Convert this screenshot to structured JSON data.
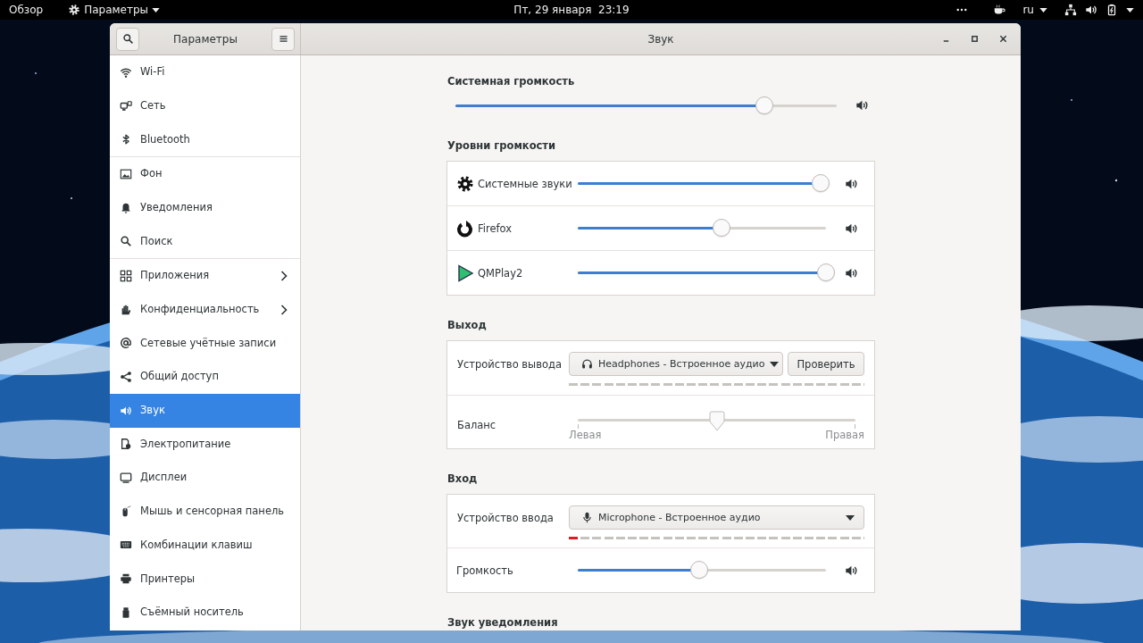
{
  "top_bar": {
    "activities": "Обзор",
    "app_menu": "Параметры",
    "clock": "Пт, 29 января  23:19",
    "language": "ru"
  },
  "window": {
    "sidebar_title": "Параметры",
    "title": "Звук"
  },
  "sidebar": {
    "groups": [
      [
        {
          "label": "Wi-Fi",
          "selected": false,
          "has_submenu": false
        },
        {
          "label": "Сеть",
          "selected": false,
          "has_submenu": false
        },
        {
          "label": "Bluetooth",
          "selected": false,
          "has_submenu": false
        }
      ],
      [
        {
          "label": "Фон",
          "selected": false,
          "has_submenu": false
        },
        {
          "label": "Уведомления",
          "selected": false,
          "has_submenu": false
        },
        {
          "label": "Поиск",
          "selected": false,
          "has_submenu": false
        }
      ],
      [
        {
          "label": "Приложения",
          "selected": false,
          "has_submenu": true
        },
        {
          "label": "Конфиденциальность",
          "selected": false,
          "has_submenu": true
        },
        {
          "label": "Сетевые учётные записи",
          "selected": false,
          "has_submenu": false
        },
        {
          "label": "Общий доступ",
          "selected": false,
          "has_submenu": false
        },
        {
          "label": "Звук",
          "selected": true,
          "has_submenu": false
        },
        {
          "label": "Электропитание",
          "selected": false,
          "has_submenu": false
        },
        {
          "label": "Дисплеи",
          "selected": false,
          "has_submenu": false
        },
        {
          "label": "Мышь и сенсорная панель",
          "selected": false,
          "has_submenu": false
        },
        {
          "label": "Комбинации клавиш",
          "selected": false,
          "has_submenu": false
        },
        {
          "label": "Принтеры",
          "selected": false,
          "has_submenu": false
        },
        {
          "label": "Съёмный носитель",
          "selected": false,
          "has_submenu": false
        }
      ]
    ]
  },
  "system_volume": {
    "heading": "Системная громкость",
    "level": 0.81
  },
  "volume_levels": {
    "heading": "Уровни громкости",
    "apps": [
      {
        "name": "Системные звуки",
        "level": 0.98
      },
      {
        "name": "Firefox",
        "level": 0.58
      },
      {
        "name": "QMPlay2",
        "level": 1.0
      }
    ]
  },
  "output": {
    "heading": "Выход",
    "device_label": "Устройство вывода",
    "device": "Headphones - Встроенное аудио",
    "test_button": "Проверить",
    "balance_label": "Баланс",
    "balance": {
      "level": 0.5,
      "left": "Левая",
      "right": "Правая"
    }
  },
  "input": {
    "heading": "Вход",
    "device_label": "Устройство ввода",
    "device": "Microphone - Встроенное аудио",
    "meter": {
      "level": 0.04
    },
    "volume": {
      "label": "Громкость",
      "level": 0.49
    }
  },
  "next_heading": "Звук уведомления"
}
